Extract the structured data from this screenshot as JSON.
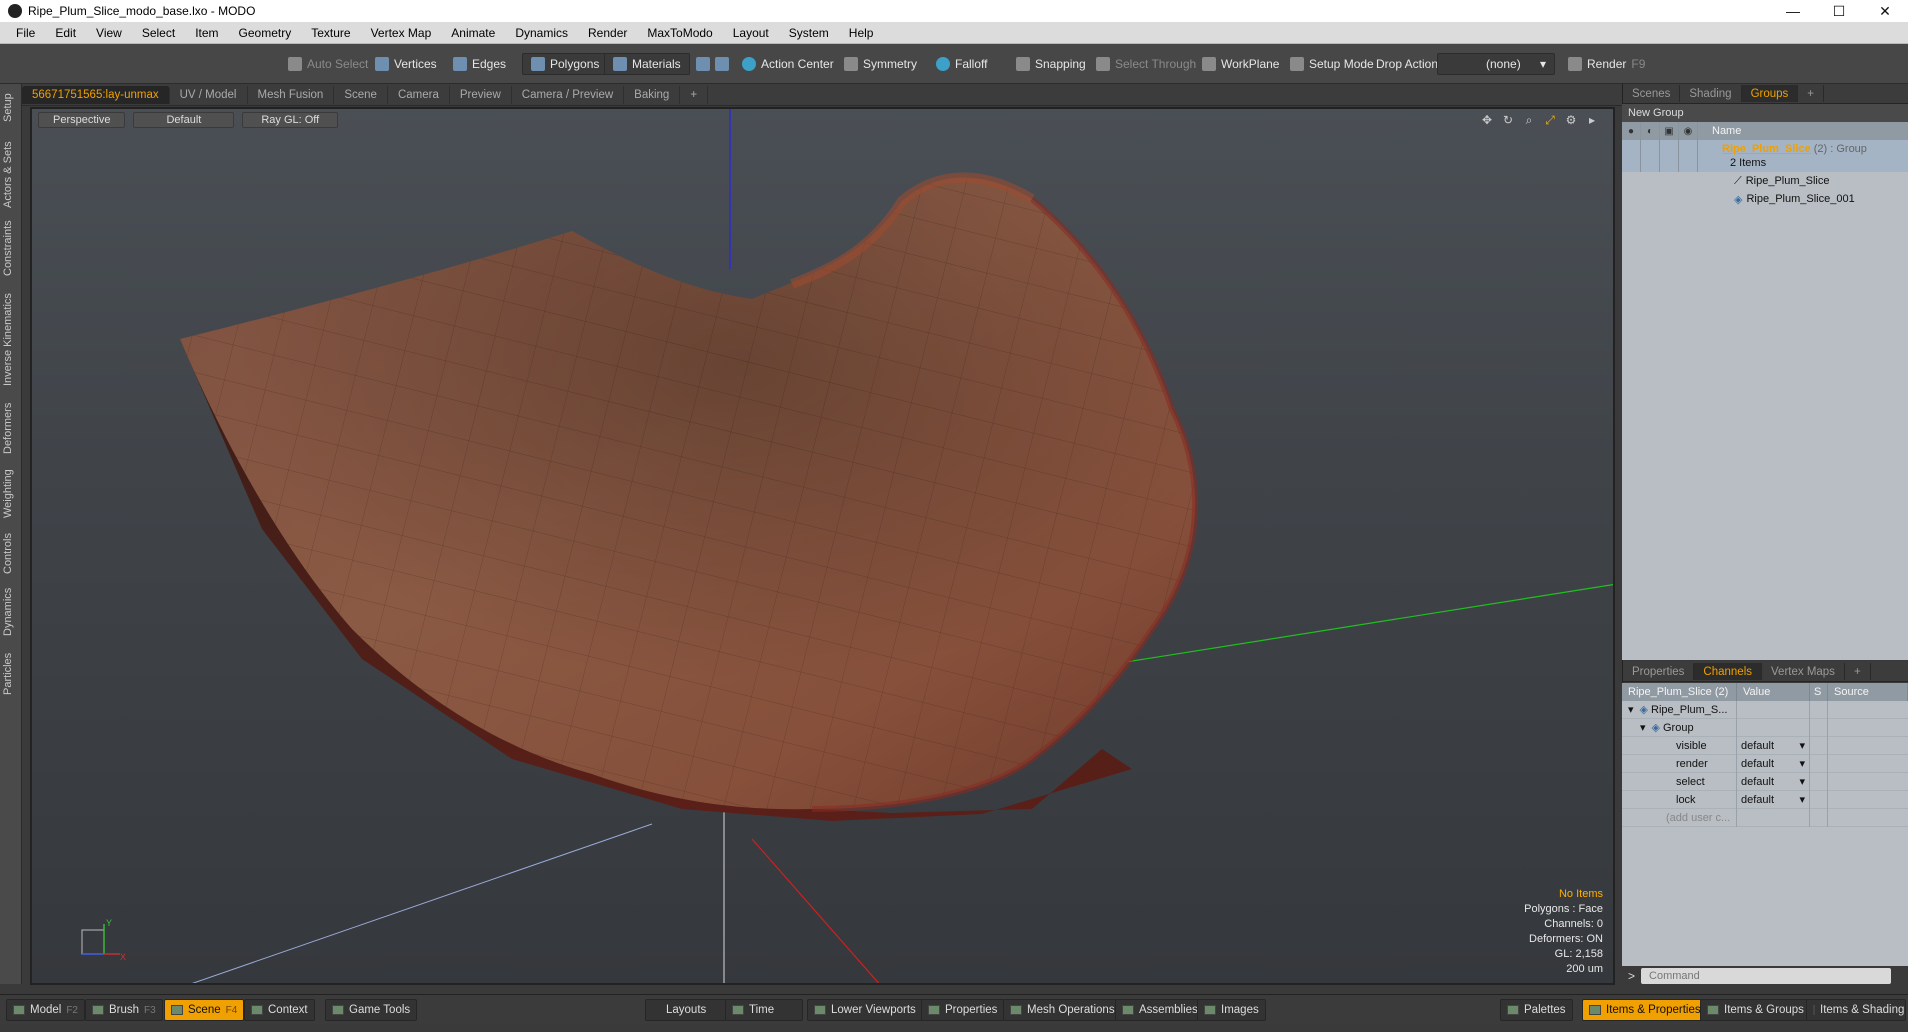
{
  "window": {
    "title": "Ripe_Plum_Slice_modo_base.lxo - MODO",
    "min": "—",
    "max": "☐",
    "close": "✕"
  },
  "menu": [
    "File",
    "Edit",
    "View",
    "Select",
    "Item",
    "Geometry",
    "Texture",
    "Vertex Map",
    "Animate",
    "Dynamics",
    "Render",
    "MaxToModo",
    "Layout",
    "System",
    "Help"
  ],
  "toolbar": {
    "auto_select": "Auto Select",
    "vertices": "Vertices",
    "edges": "Edges",
    "polygons": "Polygons",
    "materials": "Materials",
    "action_center": "Action Center",
    "symmetry": "Symmetry",
    "falloff": "Falloff",
    "snapping": "Snapping",
    "select_through": "Select Through",
    "workplane": "WorkPlane",
    "setup_mode": "Setup Mode",
    "drop_action": "Drop Action",
    "drop_value": "(none)",
    "render": "Render",
    "render_key": "F9"
  },
  "left_tabs": [
    "Setup",
    "Actors & Sets",
    "Constraints",
    "Inverse Kinematics",
    "Deformers",
    "Weighting",
    "Controls",
    "Dynamics",
    "Particles"
  ],
  "viewport_tabs": [
    "56671751565:lay-unmax",
    "UV / Model",
    "Mesh Fusion",
    "Scene",
    "Camera",
    "Preview",
    "Camera / Preview",
    "Baking",
    "+"
  ],
  "viewport": {
    "perspective": "Perspective",
    "default": "Default",
    "raygl": "Ray GL: Off",
    "axis_x": "X",
    "axis_y": "Y",
    "info": {
      "items": "No Items",
      "polygons": "Polygons : Face",
      "channels": "Channels: 0",
      "deformers": "Deformers: ON",
      "gl": "GL: 2,158",
      "scale": "200 um"
    }
  },
  "right_top_tabs": [
    "Scenes",
    "Shading",
    "Groups",
    "+"
  ],
  "groups": {
    "new_group": "New Group",
    "col_name": "Name",
    "group_name": "Ripe_Plum_Slice",
    "group_count": "(2)",
    "group_type": ": Group",
    "items_count": "2 Items",
    "children": [
      "Ripe_Plum_Slice",
      "Ripe_Plum_Slice_001"
    ]
  },
  "right_bottom_tabs": [
    "Properties",
    "Channels",
    "Vertex Maps",
    "+"
  ],
  "channels": {
    "header_item": "Ripe_Plum_Slice (2)",
    "col_value": "Value",
    "col_s": "S",
    "col_source": "Source",
    "root": "Ripe_Plum_S...",
    "group": "Group",
    "rows": [
      {
        "name": "visible",
        "value": "default"
      },
      {
        "name": "render",
        "value": "default"
      },
      {
        "name": "select",
        "value": "default"
      },
      {
        "name": "lock",
        "value": "default"
      }
    ],
    "add_user": "(add user c..."
  },
  "command": {
    "prompt": ">",
    "placeholder": "Command"
  },
  "statusbar": {
    "model": "Model",
    "model_key": "F2",
    "brush": "Brush",
    "brush_key": "F3",
    "scene": "Scene",
    "scene_key": "F4",
    "context": "Context",
    "game_tools": "Game Tools",
    "layouts": "Layouts",
    "time": "Time",
    "lower_viewports": "Lower Viewports",
    "properties": "Properties",
    "mesh_operations": "Mesh Operations",
    "assemblies": "Assemblies",
    "images": "Images",
    "palettes": "Palettes",
    "items_properties": "Items & Properties",
    "items_groups": "Items & Groups",
    "items_shading": "Items & Shading"
  },
  "colors": {
    "accent": "#f0a000",
    "viewport_bg": "#404449",
    "plum_skin": "#7a3a25"
  }
}
